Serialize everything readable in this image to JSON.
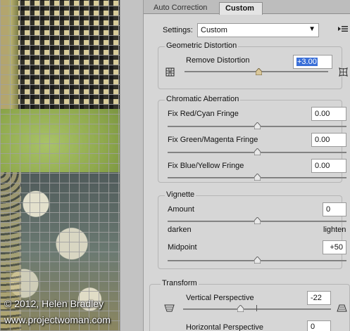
{
  "watermark": {
    "line1": "© 2012, Helen Bradley",
    "line2": "www.projectwoman.com"
  },
  "tabs": [
    {
      "label": "Auto Correction",
      "active": false
    },
    {
      "label": "Custom",
      "active": true
    }
  ],
  "settings": {
    "label": "Settings:",
    "value": "Custom",
    "caret": "▼",
    "menu_icon": "≡"
  },
  "geometric": {
    "title": "Geometric Distortion",
    "remove_label": "Remove Distortion",
    "remove_value": "+3.00",
    "remove_fraction": 0.515,
    "left_icon": "pincushion-icon",
    "right_icon": "barrel-icon"
  },
  "chromatic": {
    "title": "Chromatic Aberration",
    "rows": [
      {
        "label": "Fix Red/Cyan Fringe",
        "value": "0.00",
        "fraction": 0.5
      },
      {
        "label": "Fix Green/Magenta Fringe",
        "value": "0.00",
        "fraction": 0.5
      },
      {
        "label": "Fix Blue/Yellow Fringe",
        "value": "0.00",
        "fraction": 0.5
      }
    ]
  },
  "vignette": {
    "title": "Vignette",
    "amount_label": "Amount",
    "amount_value": "0",
    "amount_fraction": 0.5,
    "darken_label": "darken",
    "lighten_label": "lighten",
    "midpoint_label": "Midpoint",
    "midpoint_value": "+50",
    "midpoint_fraction": 0.5
  },
  "transform": {
    "title": "Transform",
    "vertical_label": "Vertical Perspective",
    "vertical_value": "-22",
    "vertical_fraction": 0.39,
    "horizontal_label": "Horizontal Perspective",
    "horizontal_value": "0"
  },
  "colors": {
    "panel_bg": "#d6d6d6",
    "selection": "#3a6fd8"
  }
}
